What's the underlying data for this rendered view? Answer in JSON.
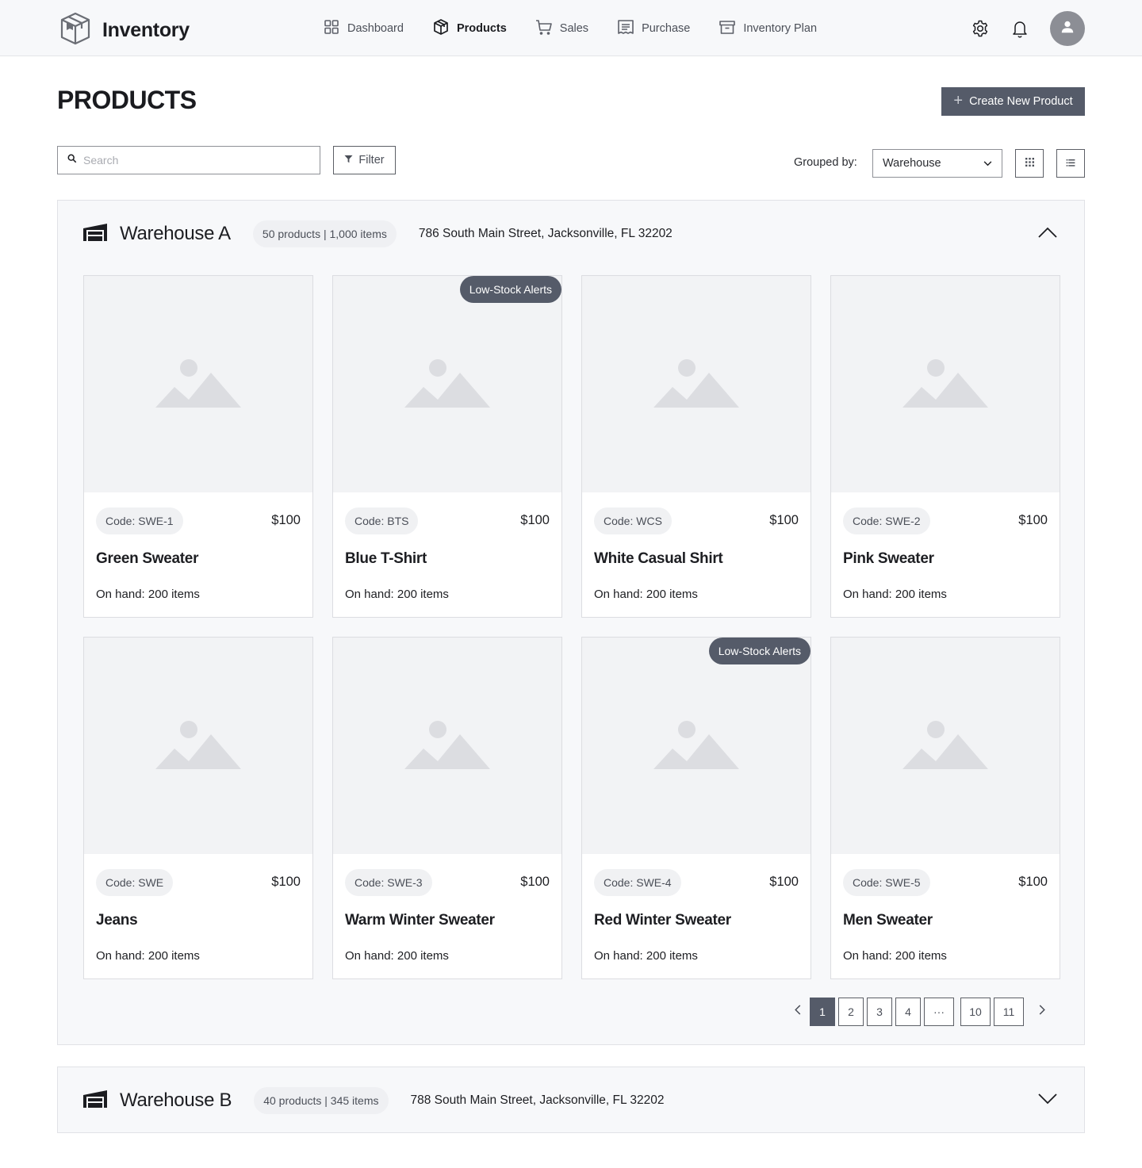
{
  "app": {
    "title": "Inventory"
  },
  "nav": {
    "items": [
      {
        "label": "Dashboard",
        "icon": "grid-icon",
        "active": false
      },
      {
        "label": "Products",
        "icon": "box-icon",
        "active": true
      },
      {
        "label": "Sales",
        "icon": "cart-icon",
        "active": false
      },
      {
        "label": "Purchase",
        "icon": "receipt-icon",
        "active": false
      },
      {
        "label": "Inventory Plan",
        "icon": "archive-icon",
        "active": false
      }
    ]
  },
  "header_icons": [
    "gear-icon",
    "bell-icon",
    "user-icon"
  ],
  "page": {
    "title": "PRODUCTS",
    "create_label": "Create New Product"
  },
  "toolbar": {
    "search_placeholder": "Search",
    "search_value": "",
    "filter_label": "Filter",
    "grouped_label": "Grouped by:",
    "grouped_value": "Warehouse"
  },
  "warehouses": [
    {
      "name": "Warehouse A",
      "stats": "50 products | 1,000 items",
      "address": "786 South Main Street, Jacksonville, FL 32202",
      "expanded": true,
      "products": [
        {
          "code": "Code: SWE-1",
          "price": "$100",
          "name": "Green Sweater",
          "on_hand": "On hand: 200 items",
          "badge": ""
        },
        {
          "code": "Code: BTS",
          "price": "$100",
          "name": "Blue T-Shirt",
          "on_hand": "On hand: 200 items",
          "badge": "Low-Stock Alerts"
        },
        {
          "code": "Code: WCS",
          "price": "$100",
          "name": "White Casual Shirt",
          "on_hand": "On hand: 200 items",
          "badge": ""
        },
        {
          "code": "Code: SWE-2",
          "price": "$100",
          "name": "Pink Sweater",
          "on_hand": "On hand: 200 items",
          "badge": ""
        },
        {
          "code": "Code: SWE",
          "price": "$100",
          "name": "Jeans",
          "on_hand": "On hand: 200 items",
          "badge": ""
        },
        {
          "code": "Code: SWE-3",
          "price": "$100",
          "name": "Warm Winter Sweater",
          "on_hand": "On hand: 200 items",
          "badge": ""
        },
        {
          "code": "Code: SWE-4",
          "price": "$100",
          "name": "Red Winter Sweater",
          "on_hand": "On hand: 200 items",
          "badge": "Low-Stock Alerts"
        },
        {
          "code": "Code: SWE-5",
          "price": "$100",
          "name": "Men Sweater",
          "on_hand": "On hand: 200 items",
          "badge": ""
        }
      ],
      "pagination": {
        "pages": [
          "1",
          "2",
          "3",
          "4",
          "···",
          "10",
          "11"
        ],
        "current": "1"
      }
    },
    {
      "name": "Warehouse B",
      "stats": "40 products | 345 items",
      "address": "788 South Main Street, Jacksonville, FL 32202",
      "expanded": false
    }
  ],
  "colors": {
    "accent": "#555b69",
    "header_bg": "#f7f8fa",
    "panel_bg": "#f7f8fa",
    "placeholder_bg": "#f2f3f5"
  }
}
